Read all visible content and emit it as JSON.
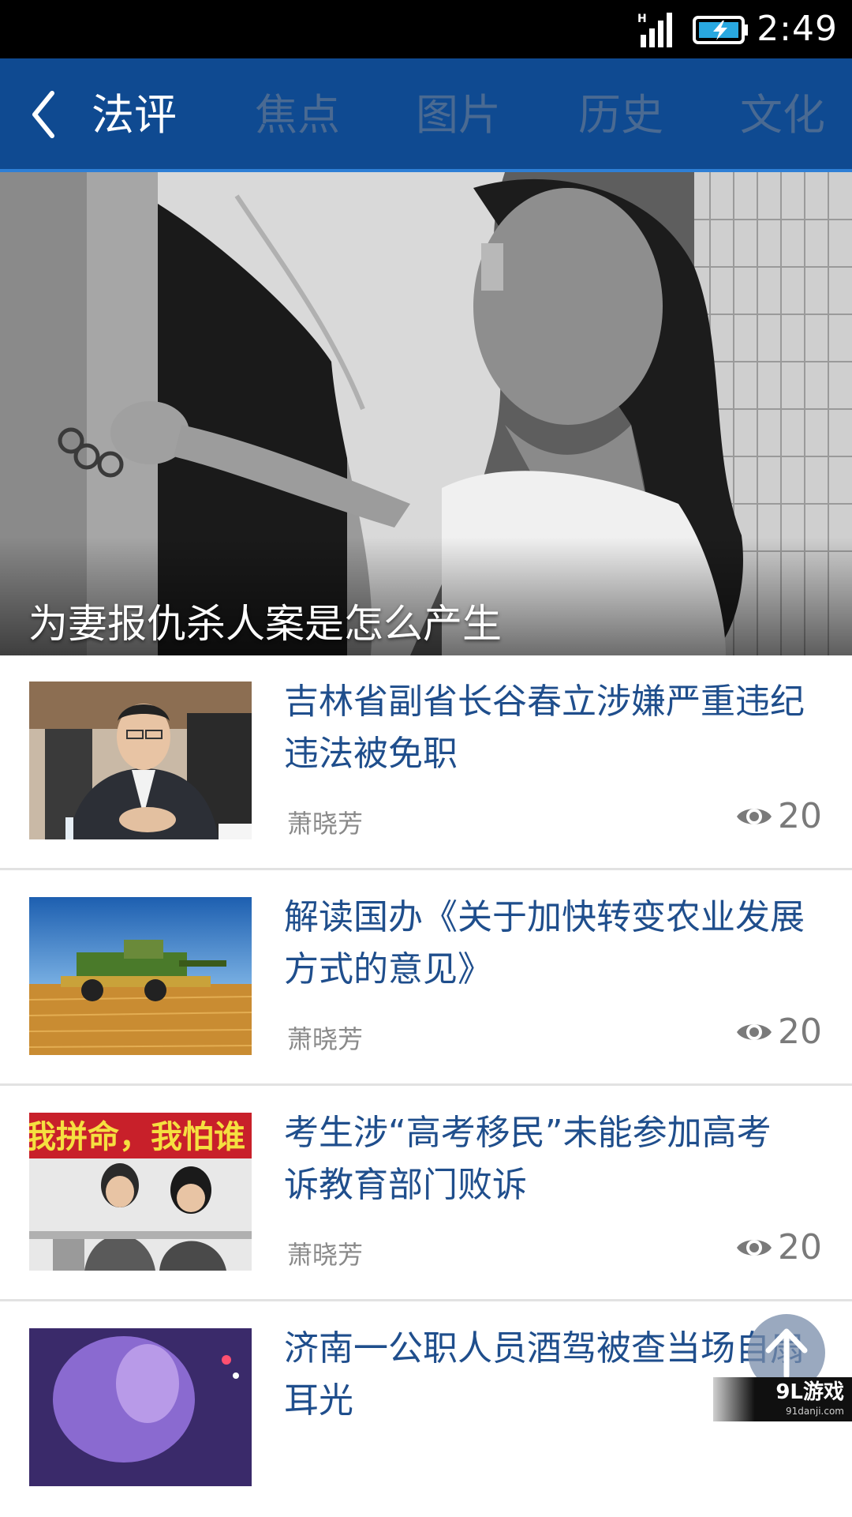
{
  "status_bar": {
    "time": "2:49",
    "icons": [
      "signal-icon",
      "battery-charging-icon"
    ]
  },
  "nav": {
    "back_icon": "chevron-left-icon",
    "tabs": [
      {
        "label": "法评",
        "active": true
      },
      {
        "label": "焦点",
        "active": false
      },
      {
        "label": "图片",
        "active": false
      },
      {
        "label": "历史",
        "active": false
      },
      {
        "label": "文化",
        "active": false
      }
    ],
    "colors": {
      "background": "#0f4a91",
      "active": "#ffffff",
      "inactive": "#4a6a92"
    }
  },
  "hero": {
    "title": "为妻报仇杀人案是怎么产生"
  },
  "news": [
    {
      "title": "吉林省副省长谷春立涉嫌严重违纪违法被免职",
      "author": "萧晓芳",
      "views": "20"
    },
    {
      "title": "解读国办《关于加快转变农业发展方式的意见》",
      "author": "萧晓芳",
      "views": "20"
    },
    {
      "title": "考生涉“高考移民”未能参加高考 诉教育部门败诉",
      "author": "萧晓芳",
      "views": "20"
    },
    {
      "title": "济南一公职人员酒驾被查当场自扇耳光",
      "author": "",
      "views": ""
    }
  ],
  "thumb_texts": {
    "banner": "我拼命，我怕谁"
  },
  "floating": {
    "scroll_top_icon": "arrow-up-icon"
  },
  "watermark": {
    "main": "9L游戏",
    "sub": "91danji.com"
  }
}
